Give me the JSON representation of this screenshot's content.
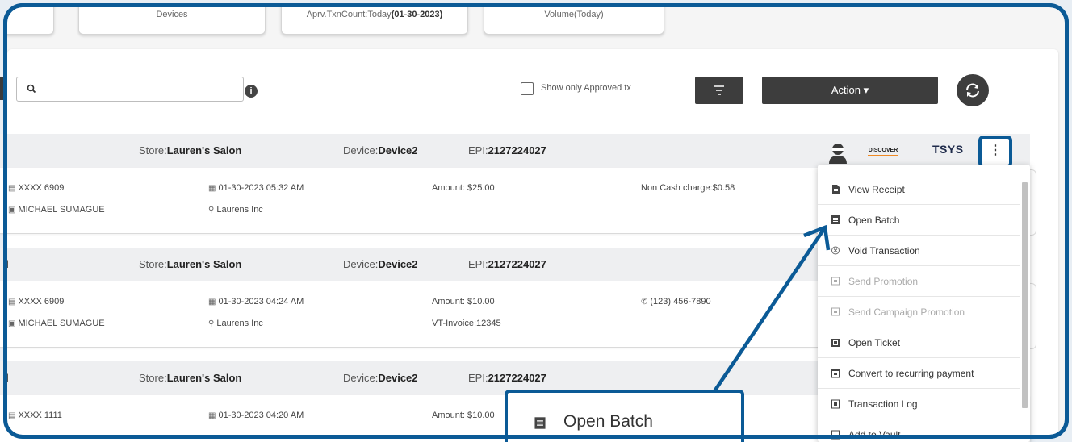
{
  "stats": {
    "card1": {
      "label": ""
    },
    "devices": {
      "label": "Devices"
    },
    "approved_count": {
      "label_prefix": "Aprv.TxnCount:Today",
      "date": "(01-30-2023)"
    },
    "volume": {
      "label": "Volume(Today)"
    }
  },
  "toolbar": {
    "search_placeholder": "",
    "search_value": "",
    "info_icon": "i",
    "approved_only_label": "Show only Approved tx",
    "approved_only_checked": false,
    "action_label": "Action ▾"
  },
  "transactions": [
    {
      "header_prefix": "",
      "store_label": "Store:",
      "store": "Lauren's Salon",
      "device_label": "Device:",
      "device": "Device2",
      "epi_label": "EPI:",
      "epi": "2127224027",
      "card": "XXXX 6909",
      "cardholder": "MICHAEL SUMAGUE",
      "datetime": "01-30-2023 05:32 AM",
      "merchant": "Laurens Inc",
      "amount": "Amount: $25.00",
      "extra_line": "",
      "side_info": "Non Cash charge:$0.58"
    },
    {
      "header_prefix": "l",
      "store_label": "Store:",
      "store": "Lauren's Salon",
      "device_label": "Device:",
      "device": "Device2",
      "epi_label": "EPI:",
      "epi": "2127224027",
      "card": "XXXX 6909",
      "cardholder": "MICHAEL SUMAGUE",
      "datetime": "01-30-2023 04:24 AM",
      "merchant": "Laurens Inc",
      "amount": "Amount: $10.00",
      "extra_line": "VT-Invoice:12345",
      "side_info": "(123) 456-7890"
    },
    {
      "header_prefix": "l",
      "store_label": "Store:",
      "store": "Lauren's Salon",
      "device_label": "Device:",
      "device": "Device2",
      "epi_label": "EPI:",
      "epi": "2127224027",
      "card": "XXXX 1111",
      "cardholder": "",
      "datetime": "01-30-2023 04:20 AM",
      "merchant": "",
      "amount": "Amount: $10.00",
      "extra_line": "",
      "side_info": ""
    }
  ],
  "row_header_icons": {
    "discover": "DISCOVER",
    "tsys": "TSYS",
    "menu_glyph": "⋮"
  },
  "menu": {
    "items": [
      {
        "label": "View Receipt",
        "icon": "receipt-icon",
        "enabled": true
      },
      {
        "label": "Open Batch",
        "icon": "batch-icon",
        "enabled": true
      },
      {
        "label": "Void Transaction",
        "icon": "void-icon",
        "enabled": true
      },
      {
        "label": "Send Promotion",
        "icon": "promotion-icon",
        "enabled": false
      },
      {
        "label": "Send Campaign Promotion",
        "icon": "campaign-icon",
        "enabled": false
      },
      {
        "label": "Open Ticket",
        "icon": "ticket-icon",
        "enabled": true
      },
      {
        "label": "Convert to recurring payment",
        "icon": "calendar-icon",
        "enabled": true
      },
      {
        "label": "Transaction Log",
        "icon": "log-icon",
        "enabled": true
      },
      {
        "label": "Add to Vault",
        "icon": "vault-icon",
        "enabled": true
      }
    ]
  },
  "callout": {
    "label": "Open Batch"
  },
  "colors": {
    "accent": "#0b5a96",
    "button_dark": "#3d3d3d",
    "header_bg": "#eeeff1"
  }
}
